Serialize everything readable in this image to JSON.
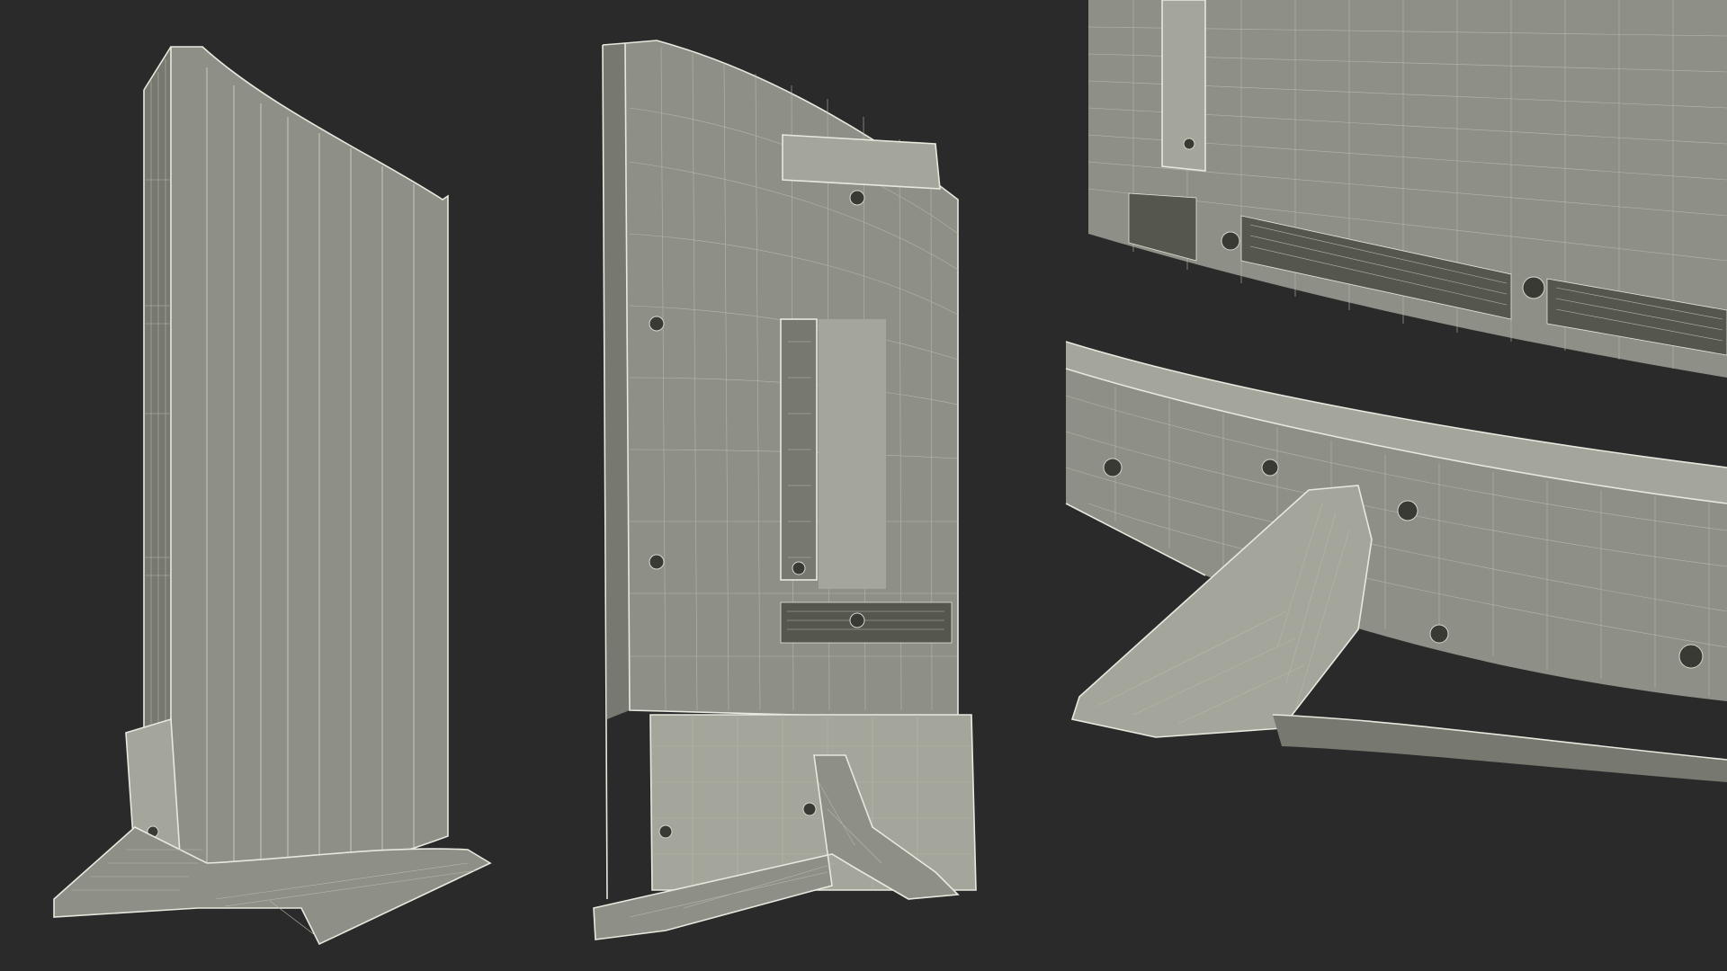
{
  "scene": {
    "background_color": "#2a2a2a",
    "wireframe_color": "#c9c9bc",
    "model_surface_color": "#8e8f86"
  },
  "views": [
    {
      "name": "side-view"
    },
    {
      "name": "back-view"
    },
    {
      "name": "closeup-stand-view"
    }
  ]
}
